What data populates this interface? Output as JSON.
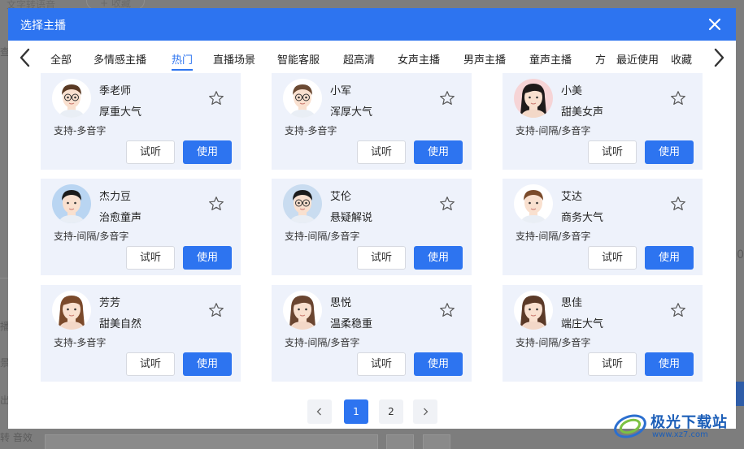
{
  "background": {
    "tab_text": "文字转语音",
    "pill_text": "+ 收藏",
    "side_fragments": [
      "查",
      "播",
      "景",
      "出",
      "转 音效"
    ],
    "right_fragment": "00"
  },
  "dialog": {
    "title": "选择主播",
    "header_color": "#2d74f0"
  },
  "tabs": {
    "items": [
      "全部",
      "多情感主播",
      "热门",
      "直播场景",
      "智能客服",
      "超高清",
      "女声主播",
      "男声主播",
      "童声主播",
      "方"
    ],
    "active": "热门",
    "right_items": [
      "最近使用",
      "收藏"
    ]
  },
  "buttons": {
    "listen": "试听",
    "use": "使用"
  },
  "voices": [
    {
      "name": "季老师",
      "style": "厚重大气",
      "support": "支持-多音字",
      "avatar": "man-glasses-icon"
    },
    {
      "name": "小军",
      "style": "浑厚大气",
      "support": "支持-多音字",
      "avatar": "man-glasses-beard-icon"
    },
    {
      "name": "小美",
      "style": "甜美女声",
      "support": "支持-间隔/多音字",
      "avatar": "woman-pink-icon"
    },
    {
      "name": "杰力豆",
      "style": "治愈童声",
      "support": "支持-间隔/多音字",
      "avatar": "boy-icon"
    },
    {
      "name": "艾伦",
      "style": "悬疑解说",
      "support": "支持-间隔/多音字",
      "avatar": "man-round-glasses-icon"
    },
    {
      "name": "艾达",
      "style": "商务大气",
      "support": "支持-间隔/多音字",
      "avatar": "man-business-icon"
    },
    {
      "name": "芳芳",
      "style": "甜美自然",
      "support": "支持-多音字",
      "avatar": "woman-short-hair-icon"
    },
    {
      "name": "思悦",
      "style": "温柔稳重",
      "support": "支持-间隔/多音字",
      "avatar": "woman-long-hair-icon"
    },
    {
      "name": "思佳",
      "style": "端庄大气",
      "support": "支持-间隔/多音字",
      "avatar": "woman-curly-hair-icon"
    }
  ],
  "pagination": {
    "pages": [
      "1",
      "2"
    ],
    "current": "1"
  },
  "watermark": {
    "text": "极光下载站",
    "url": "www.xz7.com"
  }
}
